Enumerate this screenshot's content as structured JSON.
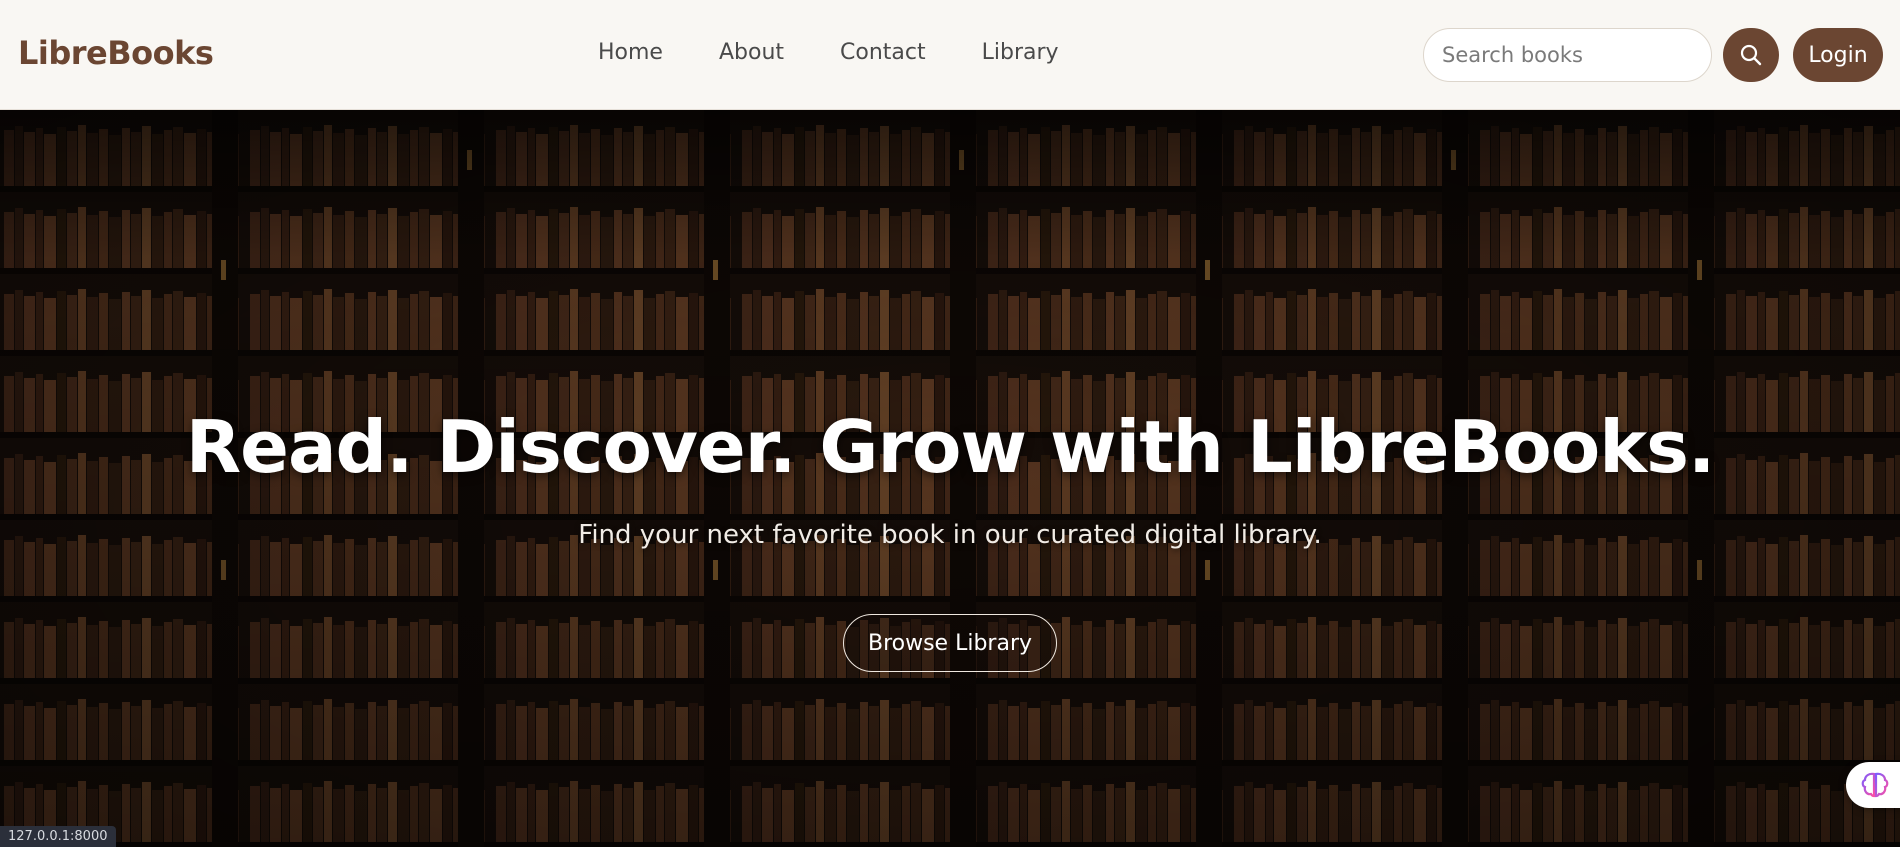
{
  "brand": {
    "name": "LibreBooks",
    "color": "#6b4632"
  },
  "nav": {
    "links": [
      {
        "label": "Home"
      },
      {
        "label": "About"
      },
      {
        "label": "Contact"
      },
      {
        "label": "Library"
      }
    ]
  },
  "search": {
    "placeholder": "Search books",
    "value": "",
    "button_icon": "search-icon"
  },
  "login": {
    "label": "Login"
  },
  "hero": {
    "title": "Read. Discover. Grow with LibreBooks.",
    "subtitle": "Find your next favorite book in our curated digital library.",
    "cta_label": "Browse Library",
    "background": "library-bookshelves-image"
  },
  "assistant_widget": {
    "icon": "brain-icon"
  },
  "status_bar": {
    "url": "127.0.0.1:8000"
  },
  "colors": {
    "nav_bg": "#f9f7f3",
    "accent": "#6b4632",
    "hero_text": "#ffffff"
  }
}
